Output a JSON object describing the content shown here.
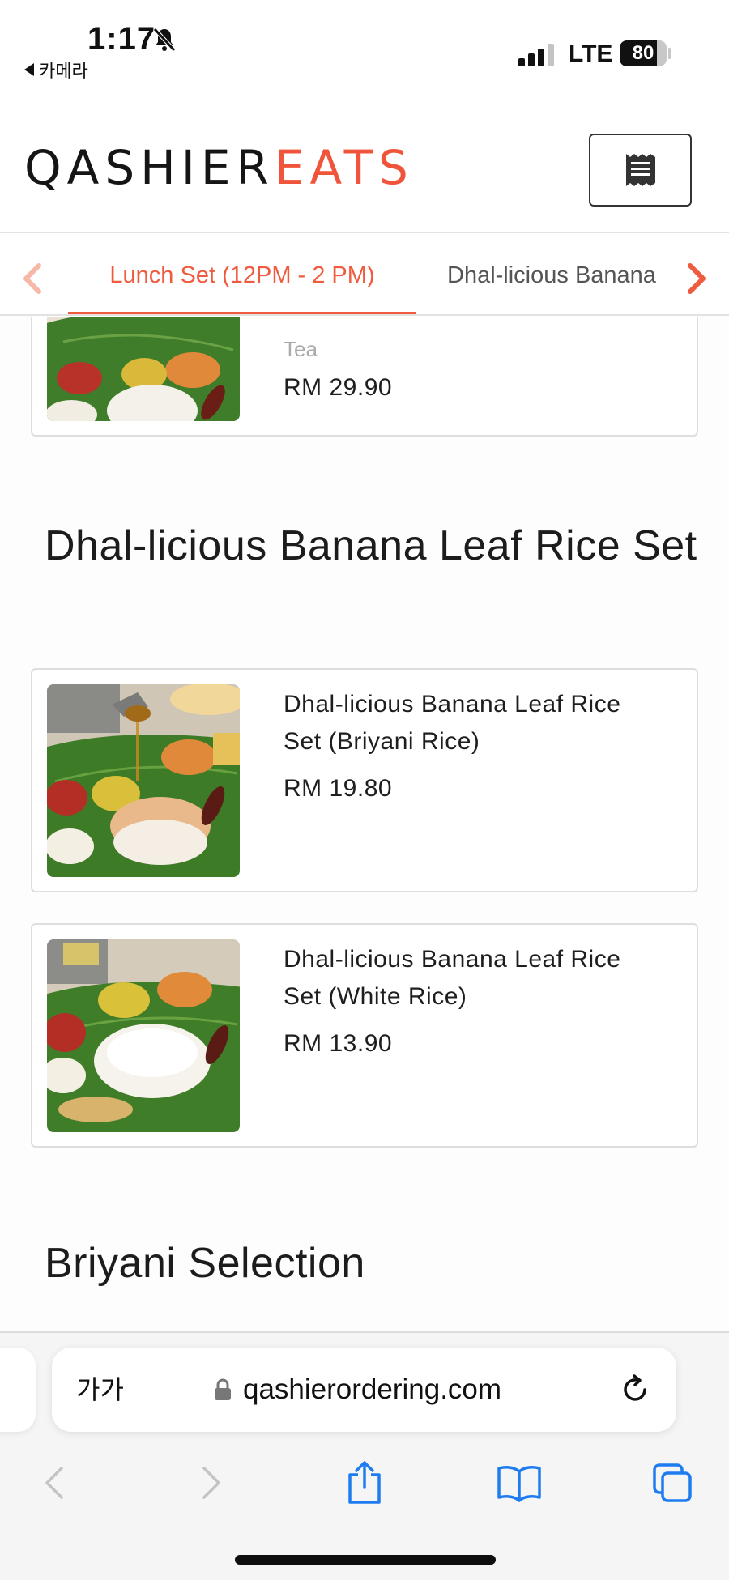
{
  "status_bar": {
    "time": "1:17",
    "back_app": "카메라",
    "network": "LTE",
    "battery": "80",
    "battery_level": 0.8
  },
  "header": {
    "logo_dark": "QASHIER",
    "logo_accent": "EATS",
    "menu_icon": "receipt-menu-icon",
    "brand_color": "#f0553c"
  },
  "categories": {
    "tabs": [
      {
        "label": "Lunch Set (12PM - 2 PM)",
        "active": true
      },
      {
        "label": "Dhal-licious Banana Leaf Rice Set",
        "active": false
      }
    ]
  },
  "partial_item": {
    "desc_fragment": "Tea",
    "price": "RM 29.90"
  },
  "sections": [
    {
      "title": "Dhal-licious Banana Leaf Rice Set",
      "items": [
        {
          "name": "Dhal-licious Banana Leaf Rice Set (Briyani Rice)",
          "price": "RM 19.80"
        },
        {
          "name": "Dhal-licious Banana Leaf Rice Set (White Rice)",
          "price": "RM 13.90"
        }
      ]
    },
    {
      "title": "Briyani Selection",
      "items": []
    }
  ],
  "browser": {
    "text_size": "가가",
    "url": "qashierordering.com"
  }
}
